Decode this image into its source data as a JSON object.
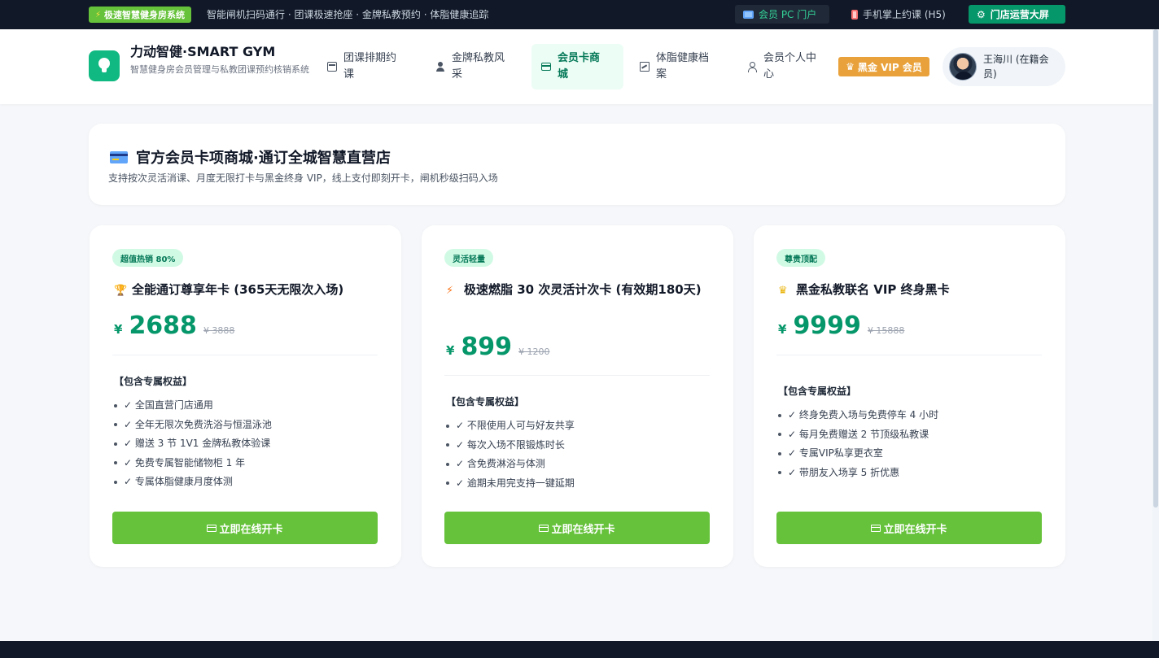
{
  "topbar": {
    "promo_icon": "lightning-icon",
    "promo_label": "极速智慧健身房系统",
    "ticker": "智能闸机扫码通行 · 团课极速抢座 · 金牌私教预约 · 体脂健康追踪",
    "pc_portal": "会员 PC 门户",
    "h5_label": "手机掌上约课 (H5)",
    "screen_label": "门店运营大屏"
  },
  "header": {
    "brand_title": "力动智健·SMART GYM",
    "brand_sub": "智慧健身房会员管理与私教团课预约核销系统",
    "nav": [
      {
        "label": "团课排期约课",
        "icon": "calendar-icon"
      },
      {
        "label": "金牌私教风采",
        "icon": "user-icon"
      },
      {
        "label": "会员卡商城",
        "icon": "card-icon"
      },
      {
        "label": "体脂健康档案",
        "icon": "chart-icon"
      },
      {
        "label": "会员个人中心",
        "icon": "person-icon"
      }
    ],
    "vip_badge": "黑金 VIP 会员",
    "user_name": "王海川 (在籍会员)"
  },
  "banner": {
    "title": "官方会员卡项商城·通订全城智慧直营店",
    "subtitle": "支持按次灵活消课、月度无限打卡与黑金终身 VIP，线上支付即刻开卡，闸机秒级扫码入场"
  },
  "cards": [
    {
      "tag": "超值热销 80%",
      "icon": "trophy-icon",
      "title": "全能通订尊享年卡 (365天无限次入场)",
      "currency": "¥",
      "price": "2688",
      "old_price": "¥ 3888",
      "benefit_head": "【包含专属权益】",
      "benefits": [
        "✓ 全国直营门店通用",
        "✓ 全年无限次免费洗浴与恒温泳池",
        "✓ 赠送 3 节 1V1 金牌私教体验课",
        "✓ 免费专属智能储物柜 1 年",
        "✓ 专属体脂健康月度体测"
      ],
      "button": "立即在线开卡"
    },
    {
      "tag": "灵活轻量",
      "icon": "lightning-icon",
      "title": "极速燃脂 30 次灵活计次卡 (有效期180天)",
      "currency": "¥",
      "price": "899",
      "old_price": "¥ 1200",
      "benefit_head": "【包含专属权益】",
      "benefits": [
        "✓ 不限使用人可与好友共享",
        "✓ 每次入场不限锻炼时长",
        "✓ 含免费淋浴与体测",
        "✓ 逾期未用完支持一键延期"
      ],
      "button": "立即在线开卡"
    },
    {
      "tag": "尊贵顶配",
      "icon": "crown-icon",
      "title": "黑金私教联名 VIP 终身黑卡",
      "currency": "¥",
      "price": "9999",
      "old_price": "¥ 15888",
      "benefit_head": "【包含专属权益】",
      "benefits": [
        "✓ 终身免费入场与免费停车 4 小时",
        "✓ 每月免费赠送 2 节顶级私教课",
        "✓ 专属VIP私享更衣室",
        "✓ 带朋友入场享 5 折优惠"
      ],
      "button": "立即在线开卡"
    }
  ],
  "colors": {
    "accent": "#059669",
    "button": "#65c23a",
    "vip": "#e9a23b",
    "topbar": "#111827"
  }
}
